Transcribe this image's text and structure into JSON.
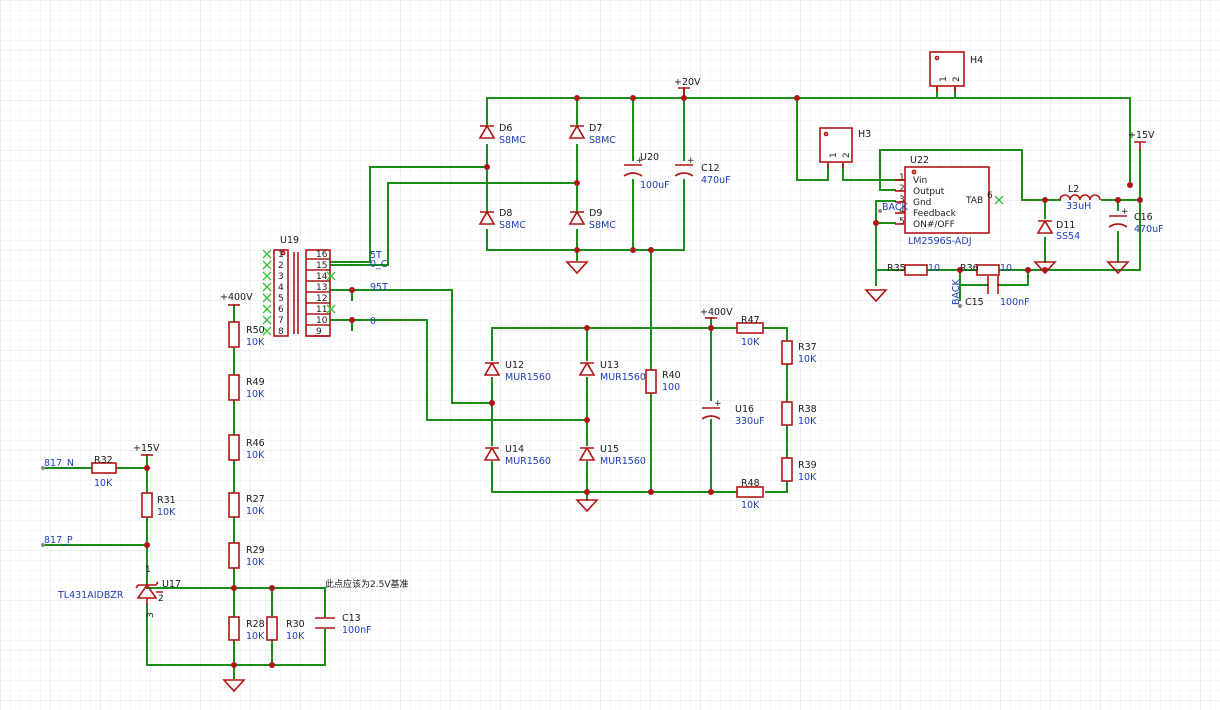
{
  "power_labels": {
    "v20": "+20V",
    "v15_right": "+15V",
    "v400_top": "+400V",
    "v400_left": "+400V",
    "v15_left": "+15V"
  },
  "headers": {
    "h4": "H4",
    "h3": "H3",
    "h4_pin1": "1",
    "h4_pin2": "2",
    "h3_pin1": "1",
    "h3_pin2": "2"
  },
  "diodes": {
    "d6": {
      "ref": "D6",
      "val": "S8MC"
    },
    "d7": {
      "ref": "D7",
      "val": "S8MC"
    },
    "d8": {
      "ref": "D8",
      "val": "S8MC"
    },
    "d9": {
      "ref": "D9",
      "val": "S8MC"
    },
    "u12": {
      "ref": "U12",
      "val": "MUR1560"
    },
    "u13": {
      "ref": "U13",
      "val": "MUR1560"
    },
    "u14": {
      "ref": "U14",
      "val": "MUR1560"
    },
    "u15": {
      "ref": "U15",
      "val": "MUR1560"
    },
    "d11": {
      "ref": "D11",
      "val": "SS54"
    }
  },
  "caps": {
    "u20": {
      "ref": "U20",
      "val": "100uF"
    },
    "c12": {
      "ref": "C12",
      "val": "470uF"
    },
    "u16": {
      "ref": "U16",
      "val": "330uF"
    },
    "c16": {
      "ref": "C16",
      "val": "470uF"
    },
    "c15": {
      "ref": "C15",
      "val": "100nF"
    },
    "c13": {
      "ref": "C13",
      "val": "100nF"
    }
  },
  "resistors": {
    "r47": {
      "ref": "R47",
      "val": "10K"
    },
    "r48": {
      "ref": "R48",
      "val": "10K"
    },
    "r37": {
      "ref": "R37",
      "val": "10K"
    },
    "r38": {
      "ref": "R38",
      "val": "10K"
    },
    "r39": {
      "ref": "R39",
      "val": "10K"
    },
    "r40": {
      "ref": "R40",
      "val": "100"
    },
    "r35": {
      "ref": "R35",
      "val": "10"
    },
    "r36": {
      "ref": "R36",
      "val": "10"
    },
    "r50": {
      "ref": "R50",
      "val": "10K"
    },
    "r49": {
      "ref": "R49",
      "val": "10K"
    },
    "r46": {
      "ref": "R46",
      "val": "10K"
    },
    "r27": {
      "ref": "R27",
      "val": "10K"
    },
    "r29": {
      "ref": "R29",
      "val": "10K"
    },
    "r28": {
      "ref": "R28",
      "val": "10K"
    },
    "r30": {
      "ref": "R30",
      "val": "10K"
    },
    "r32": {
      "ref": "R32",
      "val": "10K"
    },
    "r31": {
      "ref": "R31",
      "val": "10K"
    }
  },
  "inductor": {
    "ref": "L2",
    "val": "33uH"
  },
  "regulator": {
    "ref": "U22",
    "part": "LM2596S-ADJ",
    "pins": [
      "Vin",
      "Output",
      "Gnd",
      "Feedback",
      "ON#/OFF"
    ],
    "pin_nums": [
      "1",
      "2",
      "3",
      "4",
      "5"
    ],
    "tab": "TAB",
    "tab_num": "6"
  },
  "transformer": {
    "ref": "U19",
    "left_pins": [
      "1",
      "2",
      "3",
      "4",
      "5",
      "6",
      "7",
      "8"
    ],
    "right_pins": [
      "16",
      "15",
      "14",
      "13",
      "12",
      "11",
      "10",
      "9"
    ]
  },
  "nets": {
    "n5t": "5T",
    "n0c": "0_C",
    "n95t": "95T",
    "n0": "0",
    "back1": "BACK",
    "back2": "BACK",
    "n817n": "817_N",
    "n817p": "817_P"
  },
  "tl431": {
    "ref": "U17",
    "part": "TL431AIDBZR",
    "pin1": "1",
    "pin2": "2",
    "pin3": "3"
  },
  "annotation": "此点应该为2.5V基准"
}
